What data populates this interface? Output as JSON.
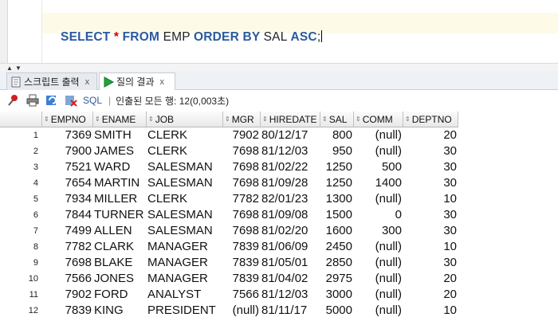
{
  "editor": {
    "query_parts": [
      {
        "text": "SELECT ",
        "kind": "kw"
      },
      {
        "text": "*",
        "kind": "star"
      },
      {
        "text": " FROM ",
        "kind": "kw"
      },
      {
        "text": "EMP ",
        "kind": "id"
      },
      {
        "text": "ORDER BY ",
        "kind": "kw"
      },
      {
        "text": "SAL ",
        "kind": "id"
      },
      {
        "text": "ASC",
        "kind": "kw"
      },
      {
        "text": ";",
        "kind": "id"
      }
    ]
  },
  "tabs": {
    "script_output": "스크립트 출력",
    "query_result": "질의 결과",
    "close_glyph": "x"
  },
  "toolbar": {
    "sql_label": "SQL",
    "status": "인출된 모든 행: 12(0,003초)",
    "separator": "|"
  },
  "grid": {
    "columns": [
      "EMPNO",
      "ENAME",
      "JOB",
      "MGR",
      "HIREDATE",
      "SAL",
      "COMM",
      "DEPTNO"
    ],
    "rows": [
      [
        "1",
        "7369",
        "SMITH",
        "CLERK",
        "7902",
        "80/12/17",
        "800",
        "(null)",
        "20"
      ],
      [
        "2",
        "7900",
        "JAMES",
        "CLERK",
        "7698",
        "81/12/03",
        "950",
        "(null)",
        "30"
      ],
      [
        "3",
        "7521",
        "WARD",
        "SALESMAN",
        "7698",
        "81/02/22",
        "1250",
        "500",
        "30"
      ],
      [
        "4",
        "7654",
        "MARTIN",
        "SALESMAN",
        "7698",
        "81/09/28",
        "1250",
        "1400",
        "30"
      ],
      [
        "5",
        "7934",
        "MILLER",
        "CLERK",
        "7782",
        "82/01/23",
        "1300",
        "(null)",
        "10"
      ],
      [
        "6",
        "7844",
        "TURNER",
        "SALESMAN",
        "7698",
        "81/09/08",
        "1500",
        "0",
        "30"
      ],
      [
        "7",
        "7499",
        "ALLEN",
        "SALESMAN",
        "7698",
        "81/02/20",
        "1600",
        "300",
        "30"
      ],
      [
        "8",
        "7782",
        "CLARK",
        "MANAGER",
        "7839",
        "81/06/09",
        "2450",
        "(null)",
        "10"
      ],
      [
        "9",
        "7698",
        "BLAKE",
        "MANAGER",
        "7839",
        "81/05/01",
        "2850",
        "(null)",
        "30"
      ],
      [
        "10",
        "7566",
        "JONES",
        "MANAGER",
        "7839",
        "81/04/02",
        "2975",
        "(null)",
        "20"
      ],
      [
        "11",
        "7902",
        "FORD",
        "ANALYST",
        "7566",
        "81/12/03",
        "3000",
        "(null)",
        "20"
      ],
      [
        "12",
        "7839",
        "KING",
        "PRESIDENT",
        "(null)",
        "81/11/17",
        "5000",
        "(null)",
        "10"
      ]
    ]
  },
  "colors": {
    "keyword": "#2a5a9e",
    "active_line": "#fdfbe8",
    "star": "#cc0000"
  }
}
